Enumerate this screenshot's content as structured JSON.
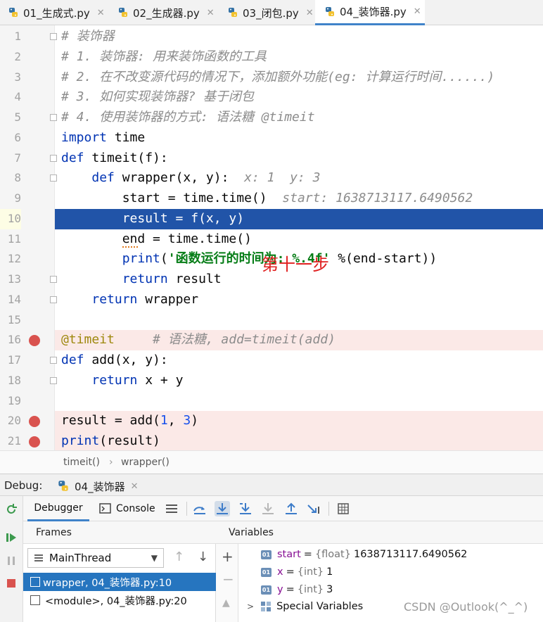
{
  "tabs": [
    {
      "label": "01_生成式.py"
    },
    {
      "label": "02_生成器.py"
    },
    {
      "label": "03_闭包.py"
    },
    {
      "label": "04_装饰器.py",
      "active": true
    }
  ],
  "editor": {
    "line_numbers": [
      "1",
      "2",
      "3",
      "4",
      "5",
      "6",
      "7",
      "8",
      "9",
      "10",
      "11",
      "12",
      "13",
      "14",
      "15",
      "16",
      "17",
      "18",
      "19",
      "20",
      "21"
    ],
    "lines": [
      {
        "segments": [
          {
            "t": "# 装饰器",
            "c": "c"
          }
        ]
      },
      {
        "segments": [
          {
            "t": "# 1. 装饰器: 用来装饰函数的工具",
            "c": "c"
          }
        ]
      },
      {
        "segments": [
          {
            "t": "# 2. 在不改变源代码的情况下，添加额外功能(eg: 计算运行时间......)",
            "c": "c"
          }
        ]
      },
      {
        "segments": [
          {
            "t": "# 3. 如何实现装饰器? 基于闭包",
            "c": "c"
          }
        ]
      },
      {
        "segments": [
          {
            "t": "# 4. 使用装饰器的方式: 语法糖 @timeit",
            "c": "c"
          }
        ]
      },
      {
        "segments": [
          {
            "t": "import",
            "c": "k"
          },
          {
            "t": " time",
            "c": ""
          }
        ]
      },
      {
        "segments": [
          {
            "t": "def",
            "c": "k"
          },
          {
            "t": " timeit(f):",
            "c": ""
          }
        ]
      },
      {
        "segments": [
          {
            "t": "    ",
            "c": ""
          },
          {
            "t": "def",
            "c": "k"
          },
          {
            "t": " wrapper(x, y):  ",
            "c": ""
          },
          {
            "t": "x: 1  y: 3",
            "c": "inl"
          }
        ]
      },
      {
        "segments": [
          {
            "t": "        start = time.time()  ",
            "c": ""
          },
          {
            "t": "start: 1638713117.6490562",
            "c": "inl"
          }
        ]
      },
      {
        "segments": [
          {
            "t": "        result = f(x, y)",
            "c": "white"
          }
        ]
      },
      {
        "segments": [
          {
            "t": "        end = time.time()",
            "c": ""
          }
        ]
      },
      {
        "segments": [
          {
            "t": "        ",
            "c": ""
          },
          {
            "t": "print",
            "c": "k"
          },
          {
            "t": "(",
            "c": ""
          },
          {
            "t": "'函数运行的时间为: %.4f'",
            "c": "s"
          },
          {
            "t": " %(end-start))",
            "c": ""
          }
        ]
      },
      {
        "segments": [
          {
            "t": "        ",
            "c": ""
          },
          {
            "t": "return",
            "c": "k"
          },
          {
            "t": " result",
            "c": ""
          }
        ]
      },
      {
        "segments": [
          {
            "t": "    ",
            "c": ""
          },
          {
            "t": "return",
            "c": "k"
          },
          {
            "t": " wrapper",
            "c": ""
          }
        ]
      },
      {
        "segments": []
      },
      {
        "segments": [
          {
            "t": "@timeit",
            "c": "dec"
          },
          {
            "t": "     ",
            "c": ""
          },
          {
            "t": "# 语法糖, add=timeit(add)",
            "c": "c"
          }
        ]
      },
      {
        "segments": [
          {
            "t": "def",
            "c": "k"
          },
          {
            "t": " add(x, y):",
            "c": ""
          }
        ]
      },
      {
        "segments": [
          {
            "t": "    ",
            "c": ""
          },
          {
            "t": "return",
            "c": "k"
          },
          {
            "t": " x + y",
            "c": ""
          }
        ]
      },
      {
        "segments": []
      },
      {
        "segments": [
          {
            "t": "result = add(",
            "c": ""
          },
          {
            "t": "1",
            "c": "n"
          },
          {
            "t": ", ",
            "c": ""
          },
          {
            "t": "3",
            "c": "n"
          },
          {
            "t": ")",
            "c": ""
          }
        ]
      },
      {
        "segments": [
          {
            "t": "print",
            "c": "k"
          },
          {
            "t": "(result)",
            "c": ""
          }
        ]
      }
    ],
    "annotation": "第十一步"
  },
  "breadcrumb": {
    "item1": "timeit()",
    "sep": "›",
    "item2": "wrapper()"
  },
  "debug": {
    "label": "Debug:",
    "run_tab": "04_装饰器",
    "tab_debugger": "Debugger",
    "tab_console": "Console",
    "frames_title": "Frames",
    "variables_title": "Variables",
    "thread": "MainThread",
    "frames": [
      "wrapper, 04_装饰器.py:10",
      "<module>, 04_装饰器.py:20"
    ],
    "variables": [
      {
        "name": "start",
        "type": "{float}",
        "value": "1638713117.6490562"
      },
      {
        "name": "x",
        "type": "{int}",
        "value": "1"
      },
      {
        "name": "y",
        "type": "{int}",
        "value": "3"
      }
    ],
    "special_variables": "Special Variables"
  },
  "watermark": "CSDN @Outlook(^_^)",
  "colors": {
    "accent": "#4083c9",
    "current_line": "#2154a8",
    "breakpoint": "#d9534f",
    "breakpoint_line": "#fbe9e7"
  }
}
